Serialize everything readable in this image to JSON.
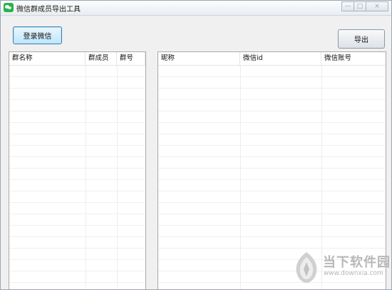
{
  "window": {
    "title": "微信群成员导出工具",
    "controls": {
      "minimize": "—",
      "maximize": "□",
      "close": "×"
    }
  },
  "toolbar": {
    "login_label": "登录微信",
    "export_label": "导出"
  },
  "groups_table": {
    "columns": [
      "群名称",
      "群成员",
      "群号"
    ],
    "rows": []
  },
  "members_table": {
    "columns": [
      "昵称",
      "微信id",
      "微信账号"
    ],
    "rows": []
  },
  "watermark": {
    "name": "当下软件园",
    "url": "www.downxia.com"
  },
  "colors": {
    "accent_border": "#3c7fb1",
    "watermark": "#b8b8b8",
    "wechat_green": "#2bb24c"
  }
}
